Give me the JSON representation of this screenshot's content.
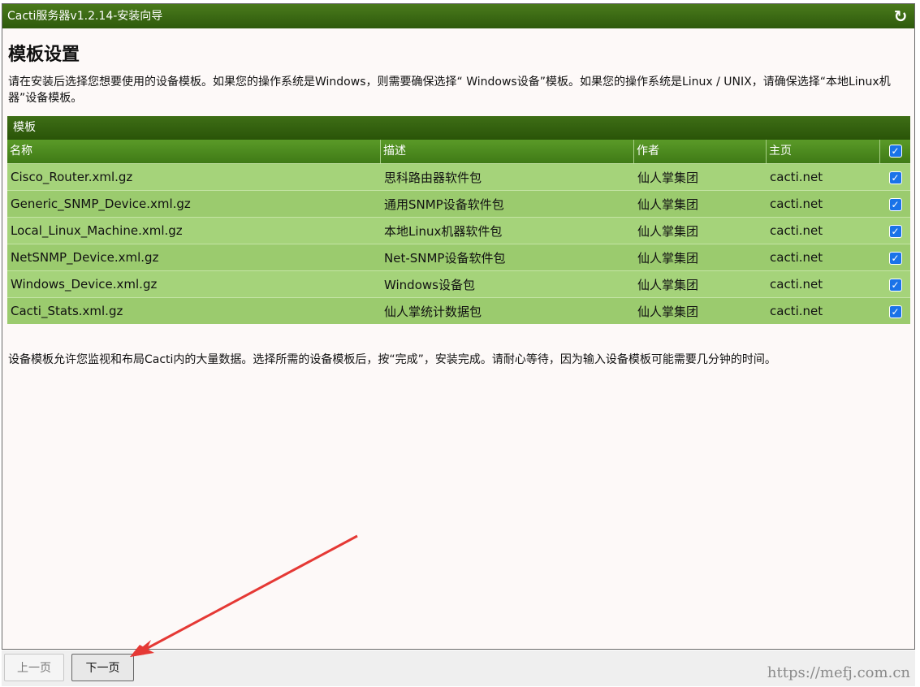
{
  "window": {
    "title": "Cacti服务器v1.2.14-安装向导",
    "refresh_icon": "refresh-icon"
  },
  "page": {
    "heading": "模板设置",
    "intro": "请在安装后选择您想要使用的设备模板。如果您的操作系统是Windows，则需要确保选择“ Windows设备”模板。如果您的操作系统是Linux / UNIX，请确保选择“本地Linux机器”设备模板。",
    "footnote": "设备模板允许您监视和布局Cacti内的大量数据。选择所需的设备模板后，按“完成”，安装完成。请耐心等待，因为输入设备模板可能需要几分钟的时间。"
  },
  "table": {
    "title": "模板",
    "headers": {
      "name": "名称",
      "desc": "描述",
      "author": "作者",
      "home": "主页"
    },
    "rows": [
      {
        "name": "Cisco_Router.xml.gz",
        "desc": "思科路由器软件包",
        "author": "仙人掌集团",
        "home": "cacti.net",
        "checked": true
      },
      {
        "name": "Generic_SNMP_Device.xml.gz",
        "desc": "通用SNMP设备软件包",
        "author": "仙人掌集团",
        "home": "cacti.net",
        "checked": true
      },
      {
        "name": "Local_Linux_Machine.xml.gz",
        "desc": "本地Linux机器软件包",
        "author": "仙人掌集团",
        "home": "cacti.net",
        "checked": true
      },
      {
        "name": "NetSNMP_Device.xml.gz",
        "desc": "Net-SNMP设备软件包",
        "author": "仙人掌集团",
        "home": "cacti.net",
        "checked": true
      },
      {
        "name": "Windows_Device.xml.gz",
        "desc": "Windows设备包",
        "author": "仙人掌集团",
        "home": "cacti.net",
        "checked": true
      },
      {
        "name": "Cacti_Stats.xml.gz",
        "desc": "仙人掌统计数据包",
        "author": "仙人掌集团",
        "home": "cacti.net",
        "checked": true
      }
    ]
  },
  "buttons": {
    "prev": "上一页",
    "next": "下一页"
  },
  "watermark": "https://mefj.com.cn",
  "colors": {
    "header_green": "#2e5a0c",
    "row_green": "#a5d37a",
    "annotation_red": "#e53935"
  }
}
